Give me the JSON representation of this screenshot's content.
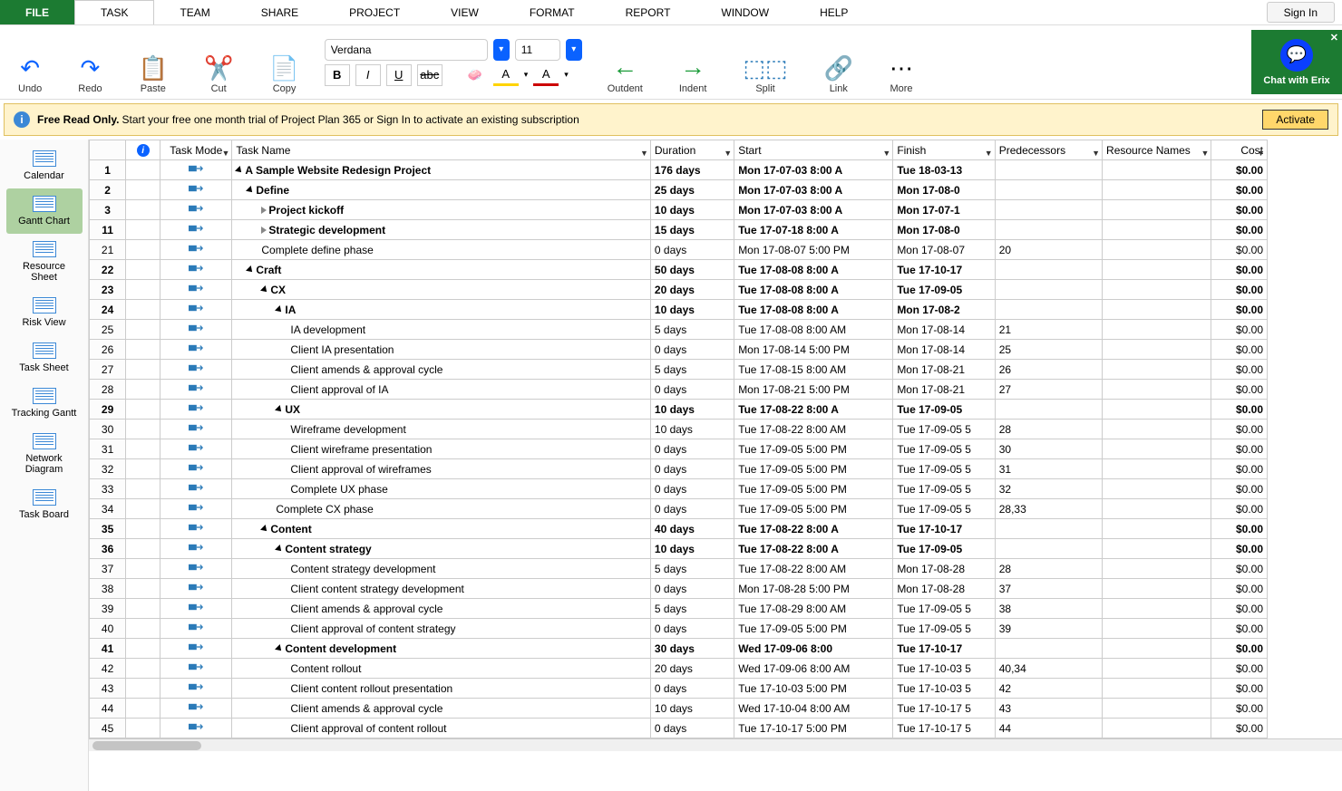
{
  "menu": [
    "FILE",
    "TASK",
    "TEAM",
    "SHARE",
    "PROJECT",
    "VIEW",
    "FORMAT",
    "REPORT",
    "WINDOW",
    "HELP"
  ],
  "active_menu": "TASK",
  "signin": "Sign In",
  "ribbon": {
    "undo": "Undo",
    "redo": "Redo",
    "paste": "Paste",
    "cut": "Cut",
    "copy": "Copy",
    "font_name": "Verdana",
    "font_size": "11",
    "outdent": "Outdent",
    "indent": "Indent",
    "split": "Split",
    "link": "Link",
    "more": "More",
    "chat": "Chat with Erix"
  },
  "banner": {
    "title": "Free Read Only.",
    "text": "Start your free one month trial of Project Plan 365 or Sign In to activate an existing subscription",
    "activate": "Activate"
  },
  "sidebar": [
    "Calendar",
    "Gantt Chart",
    "Resource Sheet",
    "Risk View",
    "Task Sheet",
    "Tracking Gantt",
    "Network Diagram",
    "Task Board"
  ],
  "sidebar_active": 1,
  "columns": [
    "",
    "",
    "Task Mode",
    "Task Name",
    "Duration",
    "Start",
    "Finish",
    "Predecessors",
    "Resource Names",
    "Cost"
  ],
  "rows": [
    {
      "n": "1",
      "b": true,
      "i": 0,
      "c": "d",
      "name": "A Sample Website Redesign Project",
      "dur": "176 days",
      "start": "Mon 17-07-03 8:00 A",
      "fin": "Tue 18-03-13",
      "pred": "",
      "cost": "$0.00"
    },
    {
      "n": "2",
      "b": true,
      "i": 1,
      "c": "d",
      "name": "Define",
      "dur": "25 days",
      "start": "Mon 17-07-03 8:00 A",
      "fin": "Mon 17-08-0",
      "pred": "",
      "cost": "$0.00"
    },
    {
      "n": "3",
      "b": true,
      "i": 2,
      "c": "r",
      "name": "Project kickoff",
      "dur": "10 days",
      "start": "Mon 17-07-03 8:00 A",
      "fin": "Mon 17-07-1",
      "pred": "",
      "cost": "$0.00"
    },
    {
      "n": "11",
      "b": true,
      "i": 2,
      "c": "r",
      "name": "Strategic development",
      "dur": "15 days",
      "start": "Tue 17-07-18 8:00 A",
      "fin": "Mon 17-08-0",
      "pred": "",
      "cost": "$0.00"
    },
    {
      "n": "21",
      "b": false,
      "i": 2,
      "c": "",
      "name": "Complete define phase",
      "dur": "0 days",
      "start": "Mon 17-08-07 5:00 PM",
      "fin": "Mon 17-08-07",
      "pred": "20",
      "cost": "$0.00"
    },
    {
      "n": "22",
      "b": true,
      "i": 1,
      "c": "d",
      "name": "Craft",
      "dur": "50 days",
      "start": "Tue 17-08-08 8:00 A",
      "fin": "Tue 17-10-17",
      "pred": "",
      "cost": "$0.00"
    },
    {
      "n": "23",
      "b": true,
      "i": 2,
      "c": "d",
      "name": "CX",
      "dur": "20 days",
      "start": "Tue 17-08-08 8:00 A",
      "fin": "Tue 17-09-05",
      "pred": "",
      "cost": "$0.00"
    },
    {
      "n": "24",
      "b": true,
      "i": 3,
      "c": "d",
      "name": "IA",
      "dur": "10 days",
      "start": "Tue 17-08-08 8:00 A",
      "fin": "Mon 17-08-2",
      "pred": "",
      "cost": "$0.00"
    },
    {
      "n": "25",
      "b": false,
      "i": 4,
      "c": "",
      "name": "IA development",
      "dur": "5 days",
      "start": "Tue 17-08-08 8:00 AM",
      "fin": "Mon 17-08-14",
      "pred": "21",
      "cost": "$0.00"
    },
    {
      "n": "26",
      "b": false,
      "i": 4,
      "c": "",
      "name": "Client IA presentation",
      "dur": "0 days",
      "start": "Mon 17-08-14 5:00 PM",
      "fin": "Mon 17-08-14",
      "pred": "25",
      "cost": "$0.00"
    },
    {
      "n": "27",
      "b": false,
      "i": 4,
      "c": "",
      "name": "Client amends & approval cycle",
      "dur": "5 days",
      "start": "Tue 17-08-15 8:00 AM",
      "fin": "Mon 17-08-21",
      "pred": "26",
      "cost": "$0.00"
    },
    {
      "n": "28",
      "b": false,
      "i": 4,
      "c": "",
      "name": "Client approval of IA",
      "dur": "0 days",
      "start": "Mon 17-08-21 5:00 PM",
      "fin": "Mon 17-08-21",
      "pred": "27",
      "cost": "$0.00"
    },
    {
      "n": "29",
      "b": true,
      "i": 3,
      "c": "d",
      "name": "UX",
      "dur": "10 days",
      "start": "Tue 17-08-22 8:00 A",
      "fin": "Tue 17-09-05",
      "pred": "",
      "cost": "$0.00"
    },
    {
      "n": "30",
      "b": false,
      "i": 4,
      "c": "",
      "name": "Wireframe development",
      "dur": "10 days",
      "start": "Tue 17-08-22 8:00 AM",
      "fin": "Tue 17-09-05 5",
      "pred": "28",
      "cost": "$0.00"
    },
    {
      "n": "31",
      "b": false,
      "i": 4,
      "c": "",
      "name": "Client wireframe presentation",
      "dur": "0 days",
      "start": "Tue 17-09-05 5:00 PM",
      "fin": "Tue 17-09-05 5",
      "pred": "30",
      "cost": "$0.00"
    },
    {
      "n": "32",
      "b": false,
      "i": 4,
      "c": "",
      "name": "Client approval of wireframes",
      "dur": "0 days",
      "start": "Tue 17-09-05 5:00 PM",
      "fin": "Tue 17-09-05 5",
      "pred": "31",
      "cost": "$0.00"
    },
    {
      "n": "33",
      "b": false,
      "i": 4,
      "c": "",
      "name": "Complete UX phase",
      "dur": "0 days",
      "start": "Tue 17-09-05 5:00 PM",
      "fin": "Tue 17-09-05 5",
      "pred": "32",
      "cost": "$0.00"
    },
    {
      "n": "34",
      "b": false,
      "i": 3,
      "c": "",
      "name": "Complete CX phase",
      "dur": "0 days",
      "start": "Tue 17-09-05 5:00 PM",
      "fin": "Tue 17-09-05 5",
      "pred": "28,33",
      "cost": "$0.00"
    },
    {
      "n": "35",
      "b": true,
      "i": 2,
      "c": "d",
      "name": "Content",
      "dur": "40 days",
      "start": "Tue 17-08-22 8:00 A",
      "fin": "Tue 17-10-17",
      "pred": "",
      "cost": "$0.00"
    },
    {
      "n": "36",
      "b": true,
      "i": 3,
      "c": "d",
      "name": "Content strategy",
      "dur": "10 days",
      "start": "Tue 17-08-22 8:00 A",
      "fin": "Tue 17-09-05",
      "pred": "",
      "cost": "$0.00"
    },
    {
      "n": "37",
      "b": false,
      "i": 4,
      "c": "",
      "name": "Content strategy development",
      "dur": "5 days",
      "start": "Tue 17-08-22 8:00 AM",
      "fin": "Mon 17-08-28",
      "pred": "28",
      "cost": "$0.00"
    },
    {
      "n": "38",
      "b": false,
      "i": 4,
      "c": "",
      "name": "Client content strategy development",
      "dur": "0 days",
      "start": "Mon 17-08-28 5:00 PM",
      "fin": "Mon 17-08-28",
      "pred": "37",
      "cost": "$0.00"
    },
    {
      "n": "39",
      "b": false,
      "i": 4,
      "c": "",
      "name": "Client amends & approval cycle",
      "dur": "5 days",
      "start": "Tue 17-08-29 8:00 AM",
      "fin": "Tue 17-09-05 5",
      "pred": "38",
      "cost": "$0.00"
    },
    {
      "n": "40",
      "b": false,
      "i": 4,
      "c": "",
      "name": "Client approval of content strategy",
      "dur": "0 days",
      "start": "Tue 17-09-05 5:00 PM",
      "fin": "Tue 17-09-05 5",
      "pred": "39",
      "cost": "$0.00"
    },
    {
      "n": "41",
      "b": true,
      "i": 3,
      "c": "d",
      "name": "Content development",
      "dur": "30 days",
      "start": "Wed 17-09-06 8:00",
      "fin": "Tue 17-10-17",
      "pred": "",
      "cost": "$0.00"
    },
    {
      "n": "42",
      "b": false,
      "i": 4,
      "c": "",
      "name": "Content rollout",
      "dur": "20 days",
      "start": "Wed 17-09-06 8:00 AM",
      "fin": "Tue 17-10-03 5",
      "pred": "40,34",
      "cost": "$0.00"
    },
    {
      "n": "43",
      "b": false,
      "i": 4,
      "c": "",
      "name": "Client content rollout presentation",
      "dur": "0 days",
      "start": "Tue 17-10-03 5:00 PM",
      "fin": "Tue 17-10-03 5",
      "pred": "42",
      "cost": "$0.00"
    },
    {
      "n": "44",
      "b": false,
      "i": 4,
      "c": "",
      "name": "Client amends & approval cycle",
      "dur": "10 days",
      "start": "Wed 17-10-04 8:00 AM",
      "fin": "Tue 17-10-17 5",
      "pred": "43",
      "cost": "$0.00"
    },
    {
      "n": "45",
      "b": false,
      "i": 4,
      "c": "",
      "name": "Client approval of content rollout",
      "dur": "0 days",
      "start": "Tue 17-10-17 5:00 PM",
      "fin": "Tue 17-10-17 5",
      "pred": "44",
      "cost": "$0.00"
    }
  ]
}
